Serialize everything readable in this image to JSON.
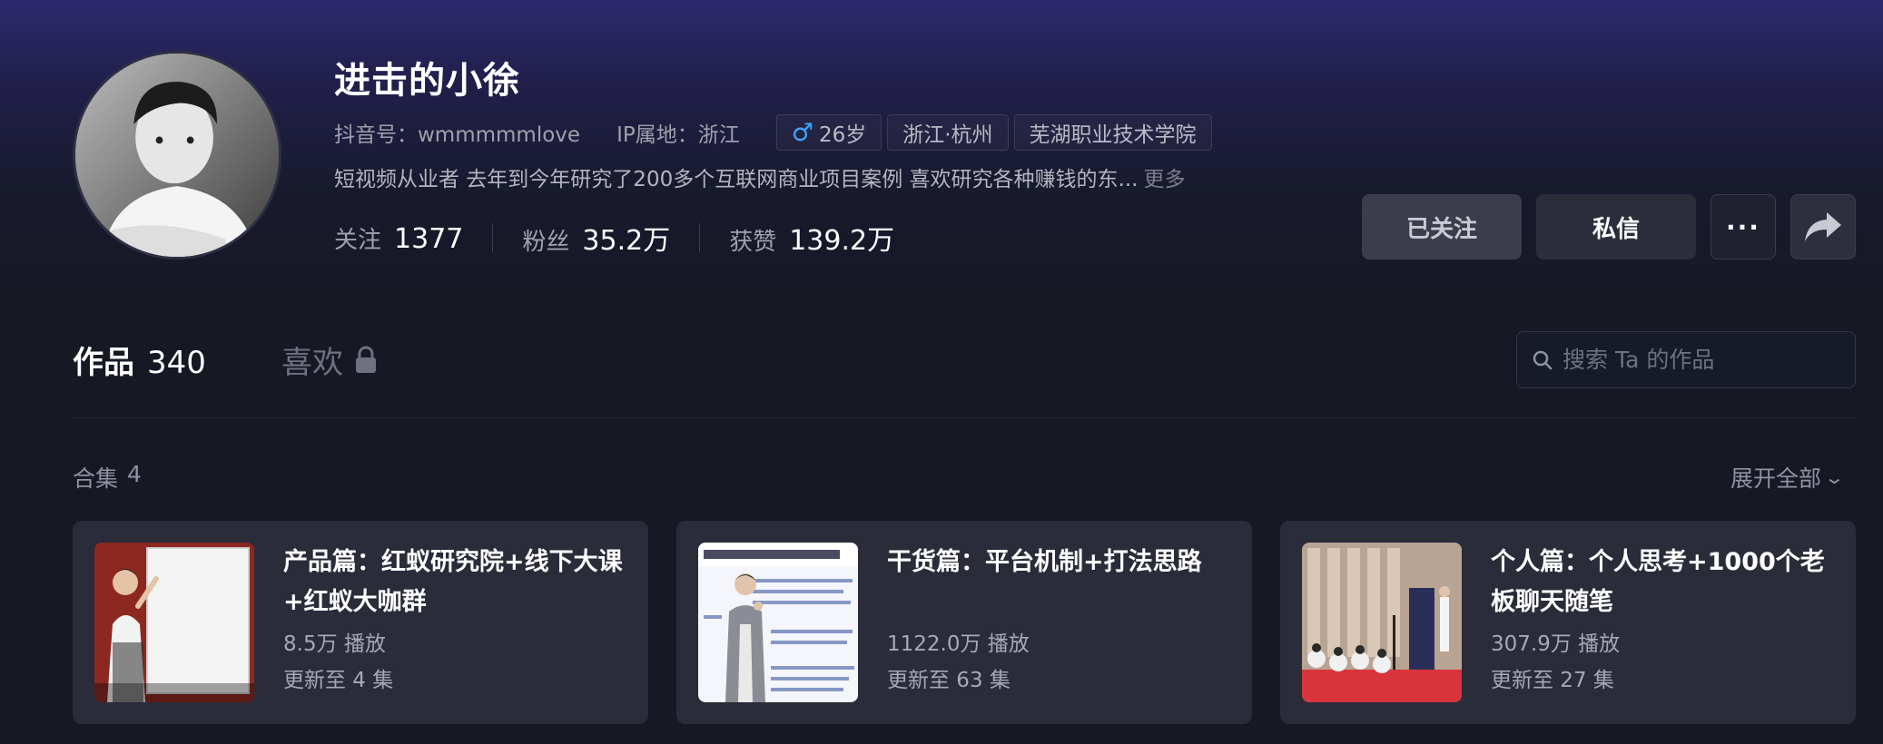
{
  "profile": {
    "nickname": "进击的小徐",
    "douyin_id": "抖音号：wmmmmmlove",
    "ip_location": "IP属地：浙江",
    "tags": {
      "age": "26岁",
      "location": "浙江·杭州",
      "school": "芜湖职业技术学院"
    },
    "bio": "短视频从业者 去年到今年研究了200多个互联网商业项目案例 喜欢研究各种赚钱的东...",
    "bio_more": "更多"
  },
  "stats": {
    "following_label": "关注",
    "following_value": "1377",
    "fans_label": "粉丝",
    "fans_value": "35.2万",
    "likes_label": "获赞",
    "likes_value": "139.2万"
  },
  "actions": {
    "followed": "已关注",
    "message": "私信",
    "more": "···"
  },
  "tabs": {
    "works_label": "作品",
    "works_count": "340",
    "likes_label": "喜欢"
  },
  "search": {
    "placeholder": "搜索 Ta 的作品"
  },
  "collections": {
    "label": "合集",
    "count": "4",
    "expand_all": "展开全部",
    "items": [
      {
        "title": "产品篇：红蚁研究院+线下大课+红蚁大咖群",
        "plays": "8.5万 播放",
        "updates": "更新至 4 集"
      },
      {
        "title": "干货篇：平台机制+打法思路",
        "plays": "1122.0万 播放",
        "updates": "更新至 63 集"
      },
      {
        "title": "个人篇：个人思考+1000个老板聊天随笔",
        "plays": "307.9万 播放",
        "updates": "更新至 27 集"
      }
    ]
  },
  "colors": {
    "background": "#161824",
    "header_gradient_top": "#2c2a6e",
    "card_bg": "#2a2c3a",
    "male_icon": "#3fa4ff"
  }
}
